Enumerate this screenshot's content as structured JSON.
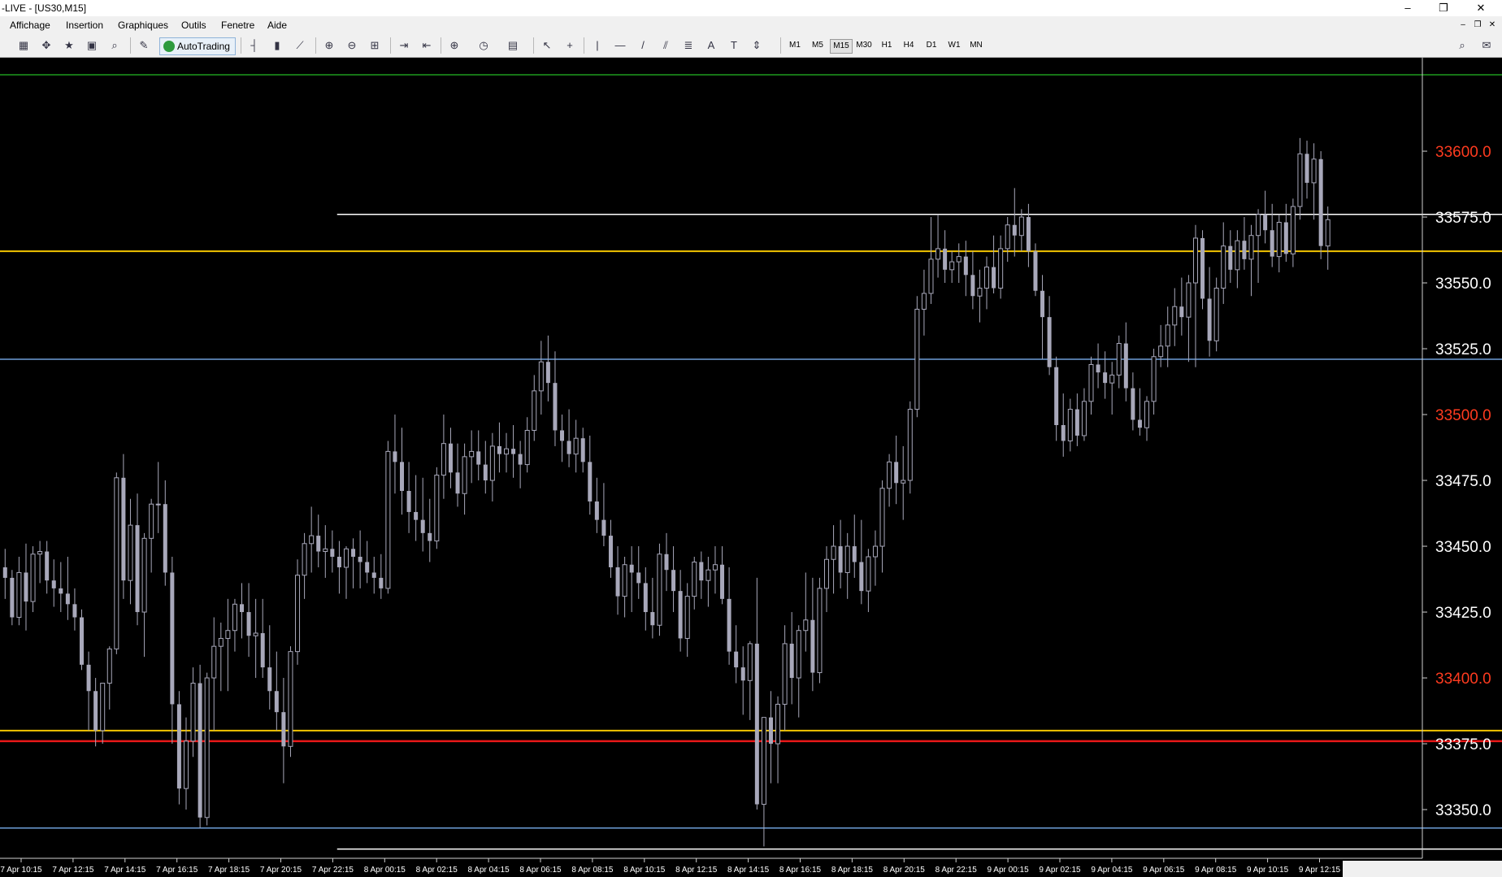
{
  "window": {
    "title": "-LIVE - [US30,M15]",
    "minimize": "–",
    "restore": "❐",
    "close": "✕"
  },
  "menu": {
    "items": [
      "Affichage",
      "Insertion",
      "Graphiques",
      "Outils",
      "Fenetre",
      "Aide"
    ]
  },
  "toolbar": {
    "autotrading_label": "AutoTrading",
    "timeframes": [
      "M1",
      "M5",
      "M15",
      "M30",
      "H1",
      "H4",
      "D1",
      "W1",
      "MN"
    ],
    "active_timeframe": "M15"
  },
  "chart_data": {
    "type": "candlestick",
    "symbol": "US30",
    "timeframe": "M15",
    "ylim": [
      33331.5,
      33635.5
    ],
    "y_ticks": [
      {
        "value": 33600,
        "label": "33600.0",
        "color": "#ff3b1f"
      },
      {
        "value": 33575,
        "label": "33575.0",
        "color": "#ffffff"
      },
      {
        "value": 33550,
        "label": "33550.0",
        "color": "#ffffff"
      },
      {
        "value": 33525,
        "label": "33525.0",
        "color": "#ffffff"
      },
      {
        "value": 33500,
        "label": "33500.0",
        "color": "#ff3b1f"
      },
      {
        "value": 33475,
        "label": "33475.0",
        "color": "#ffffff"
      },
      {
        "value": 33450,
        "label": "33450.0",
        "color": "#ffffff"
      },
      {
        "value": 33425,
        "label": "33425.0",
        "color": "#ffffff"
      },
      {
        "value": 33400,
        "label": "33400.0",
        "color": "#ff3b1f"
      },
      {
        "value": 33375,
        "label": "33375.0",
        "color": "#ffffff"
      },
      {
        "value": 33350,
        "label": "33350.0",
        "color": "#ffffff"
      }
    ],
    "x_labels": [
      "7 Apr 10:15",
      "7 Apr 12:15",
      "7 Apr 14:15",
      "7 Apr 16:15",
      "7 Apr 18:15",
      "7 Apr 20:15",
      "7 Apr 22:15",
      "8 Apr 00:15",
      "8 Apr 02:15",
      "8 Apr 04:15",
      "8 Apr 06:15",
      "8 Apr 08:15",
      "8 Apr 10:15",
      "8 Apr 12:15",
      "8 Apr 14:15",
      "8 Apr 16:15",
      "8 Apr 18:15",
      "8 Apr 20:15",
      "8 Apr 22:15",
      "9 Apr 00:15",
      "9 Apr 02:15",
      "9 Apr 04:15",
      "9 Apr 06:15",
      "9 Apr 08:15",
      "9 Apr 10:15",
      "9 Apr 12:15"
    ],
    "levels": [
      {
        "price": 33629,
        "color": "#1e9a1e",
        "width": 1.5,
        "start": 0
      },
      {
        "price": 33576,
        "color": "#ffffff",
        "width": 1.5,
        "start": 0.237
      },
      {
        "price": 33562,
        "color": "#f2c400",
        "width": 2,
        "start": 0
      },
      {
        "price": 33521,
        "color": "#6e9ed8",
        "width": 1.5,
        "start": 0
      },
      {
        "price": 33380,
        "color": "#f2c400",
        "width": 2,
        "start": 0
      },
      {
        "price": 33376,
        "color": "#e81818",
        "width": 2.5,
        "start": 0
      },
      {
        "price": 33343,
        "color": "#6e9ed8",
        "width": 1.5,
        "start": 0
      },
      {
        "price": 33335,
        "color": "#ffffff",
        "width": 1.5,
        "start": 0.237
      }
    ],
    "candles": [
      [
        33442,
        33449,
        33430,
        33438
      ],
      [
        33438,
        33441,
        33420,
        33423
      ],
      [
        33423,
        33446,
        33420,
        33440
      ],
      [
        33440,
        33451,
        33418,
        33429
      ],
      [
        33429,
        33450,
        33425,
        33447
      ],
      [
        33447,
        33452,
        33436,
        33448
      ],
      [
        33448,
        33452,
        33432,
        33437
      ],
      [
        33437,
        33445,
        33427,
        33434
      ],
      [
        33434,
        33444,
        33425,
        33432
      ],
      [
        33432,
        33446,
        33422,
        33428
      ],
      [
        33428,
        33434,
        33418,
        33423
      ],
      [
        33423,
        33426,
        33403,
        33405
      ],
      [
        33405,
        33410,
        33380,
        33395
      ],
      [
        33395,
        33400,
        33374,
        33380
      ],
      [
        33380,
        33396,
        33375,
        33398
      ],
      [
        33398,
        33412,
        33388,
        33411
      ],
      [
        33411,
        33478,
        33409,
        33476
      ],
      [
        33476,
        33485,
        33430,
        33437
      ],
      [
        33437,
        33468,
        33428,
        33458
      ],
      [
        33458,
        33470,
        33420,
        33425
      ],
      [
        33425,
        33455,
        33408,
        33453
      ],
      [
        33453,
        33468,
        33440,
        33466
      ],
      [
        33466,
        33482,
        33455,
        33466
      ],
      [
        33466,
        33475,
        33435,
        33440
      ],
      [
        33440,
        33446,
        33375,
        33390
      ],
      [
        33390,
        33395,
        33352,
        33358
      ],
      [
        33358,
        33385,
        33350,
        33376
      ],
      [
        33376,
        33404,
        33370,
        33398
      ],
      [
        33398,
        33405,
        33343,
        33347
      ],
      [
        33347,
        33402,
        33344,
        33400
      ],
      [
        33400,
        33423,
        33380,
        33412
      ],
      [
        33412,
        33421,
        33395,
        33415
      ],
      [
        33415,
        33430,
        33395,
        33418
      ],
      [
        33418,
        33430,
        33410,
        33428
      ],
      [
        33428,
        33436,
        33415,
        33425
      ],
      [
        33425,
        33436,
        33408,
        33416
      ],
      [
        33416,
        33430,
        33400,
        33417
      ],
      [
        33417,
        33430,
        33400,
        33404
      ],
      [
        33404,
        33420,
        33388,
        33395
      ],
      [
        33395,
        33410,
        33380,
        33387
      ],
      [
        33387,
        33400,
        33360,
        33374
      ],
      [
        33374,
        33412,
        33370,
        33410
      ],
      [
        33410,
        33445,
        33405,
        33439
      ],
      [
        33439,
        33455,
        33430,
        33451
      ],
      [
        33451,
        33465,
        33440,
        33454
      ],
      [
        33454,
        33462,
        33442,
        33448
      ],
      [
        33448,
        33458,
        33438,
        33449
      ],
      [
        33449,
        33456,
        33440,
        33446
      ],
      [
        33446,
        33452,
        33432,
        33442
      ],
      [
        33442,
        33450,
        33430,
        33449
      ],
      [
        33449,
        33453,
        33434,
        33446
      ],
      [
        33446,
        33456,
        33434,
        33444
      ],
      [
        33444,
        33452,
        33436,
        33440
      ],
      [
        33440,
        33446,
        33432,
        33438
      ],
      [
        33438,
        33447,
        33430,
        33434
      ],
      [
        33434,
        33490,
        33432,
        33486
      ],
      [
        33486,
        33500,
        33470,
        33482
      ],
      [
        33482,
        33495,
        33462,
        33471
      ],
      [
        33471,
        33482,
        33455,
        33463
      ],
      [
        33463,
        33477,
        33452,
        33460
      ],
      [
        33460,
        33476,
        33448,
        33455
      ],
      [
        33455,
        33468,
        33444,
        33452
      ],
      [
        33452,
        33480,
        33449,
        33477
      ],
      [
        33477,
        33500,
        33468,
        33489
      ],
      [
        33489,
        33495,
        33472,
        33478
      ],
      [
        33478,
        33489,
        33465,
        33470
      ],
      [
        33470,
        33489,
        33462,
        33484
      ],
      [
        33484,
        33494,
        33474,
        33486
      ],
      [
        33486,
        33494,
        33475,
        33481
      ],
      [
        33481,
        33490,
        33470,
        33475
      ],
      [
        33475,
        33493,
        33467,
        33488
      ],
      [
        33488,
        33497,
        33478,
        33485
      ],
      [
        33485,
        33493,
        33478,
        33487
      ],
      [
        33487,
        33496,
        33476,
        33485
      ],
      [
        33485,
        33490,
        33472,
        33481
      ],
      [
        33481,
        33499,
        33478,
        33494
      ],
      [
        33494,
        33515,
        33490,
        33509
      ],
      [
        33509,
        33528,
        33500,
        33520
      ],
      [
        33520,
        33530,
        33505,
        33512
      ],
      [
        33512,
        33524,
        33488,
        33494
      ],
      [
        33494,
        33500,
        33482,
        33490
      ],
      [
        33490,
        33502,
        33480,
        33485
      ],
      [
        33485,
        33498,
        33478,
        33491
      ],
      [
        33491,
        33495,
        33478,
        33482
      ],
      [
        33482,
        33492,
        33462,
        33467
      ],
      [
        33467,
        33476,
        33455,
        33460
      ],
      [
        33460,
        33474,
        33450,
        33454
      ],
      [
        33454,
        33460,
        33438,
        33442
      ],
      [
        33442,
        33450,
        33424,
        33431
      ],
      [
        33431,
        33446,
        33423,
        33443
      ],
      [
        33443,
        33450,
        33425,
        33440
      ],
      [
        33440,
        33450,
        33430,
        33436
      ],
      [
        33436,
        33442,
        33418,
        33425
      ],
      [
        33425,
        33438,
        33415,
        33420
      ],
      [
        33420,
        33451,
        33416,
        33447
      ],
      [
        33447,
        33455,
        33433,
        33441
      ],
      [
        33441,
        33450,
        33425,
        33433
      ],
      [
        33433,
        33441,
        33410,
        33415
      ],
      [
        33415,
        33436,
        33408,
        33431
      ],
      [
        33431,
        33446,
        33426,
        33444
      ],
      [
        33444,
        33448,
        33430,
        33437
      ],
      [
        33437,
        33446,
        33427,
        33441
      ],
      [
        33441,
        33450,
        33432,
        33443
      ],
      [
        33443,
        33450,
        33428,
        33430
      ],
      [
        33430,
        33442,
        33405,
        33410
      ],
      [
        33410,
        33420,
        33398,
        33404
      ],
      [
        33404,
        33412,
        33386,
        33399
      ],
      [
        33399,
        33414,
        33384,
        33413
      ],
      [
        33413,
        33438,
        33350,
        33352
      ],
      [
        33352,
        33380,
        33336,
        33385
      ],
      [
        33385,
        33395,
        33360,
        33375
      ],
      [
        33375,
        33393,
        33360,
        33390
      ],
      [
        33390,
        33420,
        33380,
        33413
      ],
      [
        33413,
        33425,
        33390,
        33400
      ],
      [
        33400,
        33420,
        33385,
        33418
      ],
      [
        33418,
        33440,
        33410,
        33422
      ],
      [
        33422,
        33438,
        33395,
        33402
      ],
      [
        33402,
        33438,
        33398,
        33434
      ],
      [
        33434,
        33450,
        33425,
        33445
      ],
      [
        33445,
        33458,
        33432,
        33450
      ],
      [
        33450,
        33460,
        33434,
        33440
      ],
      [
        33440,
        33455,
        33430,
        33450
      ],
      [
        33450,
        33462,
        33438,
        33444
      ],
      [
        33444,
        33460,
        33428,
        33433
      ],
      [
        33433,
        33449,
        33425,
        33446
      ],
      [
        33446,
        33456,
        33435,
        33450
      ],
      [
        33450,
        33475,
        33440,
        33472
      ],
      [
        33472,
        33485,
        33465,
        33482
      ],
      [
        33482,
        33492,
        33466,
        33474
      ],
      [
        33474,
        33488,
        33460,
        33475
      ],
      [
        33475,
        33505,
        33470,
        33502
      ],
      [
        33502,
        33545,
        33499,
        33540
      ],
      [
        33540,
        33555,
        33530,
        33546
      ],
      [
        33546,
        33575,
        33542,
        33559
      ],
      [
        33559,
        33576,
        33552,
        33563
      ],
      [
        33563,
        33570,
        33550,
        33555
      ],
      [
        33555,
        33562,
        33550,
        33558
      ],
      [
        33558,
        33565,
        33550,
        33560
      ],
      [
        33560,
        33566,
        33545,
        33553
      ],
      [
        33553,
        33562,
        33540,
        33545
      ],
      [
        33545,
        33555,
        33535,
        33548
      ],
      [
        33548,
        33560,
        33540,
        33556
      ],
      [
        33556,
        33568,
        33546,
        33548
      ],
      [
        33548,
        33568,
        33544,
        33563
      ],
      [
        33563,
        33575,
        33558,
        33572
      ],
      [
        33572,
        33586,
        33560,
        33568
      ],
      [
        33568,
        33578,
        33562,
        33575
      ],
      [
        33575,
        33580,
        33556,
        33562
      ],
      [
        33562,
        33565,
        33545,
        33547
      ],
      [
        33547,
        33553,
        33521,
        33537
      ],
      [
        33537,
        33545,
        33515,
        33518
      ],
      [
        33518,
        33522,
        33490,
        33496
      ],
      [
        33496,
        33508,
        33484,
        33490
      ],
      [
        33490,
        33506,
        33486,
        33502
      ],
      [
        33502,
        33508,
        33488,
        33492
      ],
      [
        33492,
        33510,
        33490,
        33505
      ],
      [
        33505,
        33522,
        33500,
        33519
      ],
      [
        33519,
        33527,
        33510,
        33516
      ],
      [
        33516,
        33524,
        33506,
        33512
      ],
      [
        33512,
        33520,
        33500,
        33515
      ],
      [
        33515,
        33530,
        33510,
        33527
      ],
      [
        33527,
        33535,
        33505,
        33510
      ],
      [
        33510,
        33516,
        33494,
        33498
      ],
      [
        33498,
        33510,
        33492,
        33495
      ],
      [
        33495,
        33507,
        33490,
        33505
      ],
      [
        33505,
        33525,
        33500,
        33522
      ],
      [
        33522,
        33534,
        33518,
        33526
      ],
      [
        33526,
        33541,
        33518,
        33534
      ],
      [
        33534,
        33548,
        33526,
        33541
      ],
      [
        33541,
        33552,
        33530,
        33537
      ],
      [
        33537,
        33553,
        33520,
        33550
      ],
      [
        33550,
        33572,
        33518,
        33567
      ],
      [
        33567,
        33570,
        33540,
        33544
      ],
      [
        33544,
        33556,
        33522,
        33528
      ],
      [
        33528,
        33552,
        33524,
        33548
      ],
      [
        33548,
        33573,
        33542,
        33564
      ],
      [
        33564,
        33570,
        33550,
        33555
      ],
      [
        33555,
        33570,
        33548,
        33566
      ],
      [
        33566,
        33575,
        33555,
        33559
      ],
      [
        33559,
        33572,
        33545,
        33568
      ],
      [
        33568,
        33578,
        33550,
        33576
      ],
      [
        33576,
        33585,
        33565,
        33570
      ],
      [
        33570,
        33580,
        33556,
        33560
      ],
      [
        33560,
        33576,
        33554,
        33573
      ],
      [
        33573,
        33580,
        33558,
        33561
      ],
      [
        33561,
        33582,
        33556,
        33579
      ],
      [
        33579,
        33605,
        33574,
        33599
      ],
      [
        33599,
        33604,
        33582,
        33588
      ],
      [
        33588,
        33603,
        33574,
        33597
      ],
      [
        33597,
        33600,
        33559,
        33564
      ],
      [
        33564,
        33579,
        33555,
        33574
      ]
    ]
  }
}
